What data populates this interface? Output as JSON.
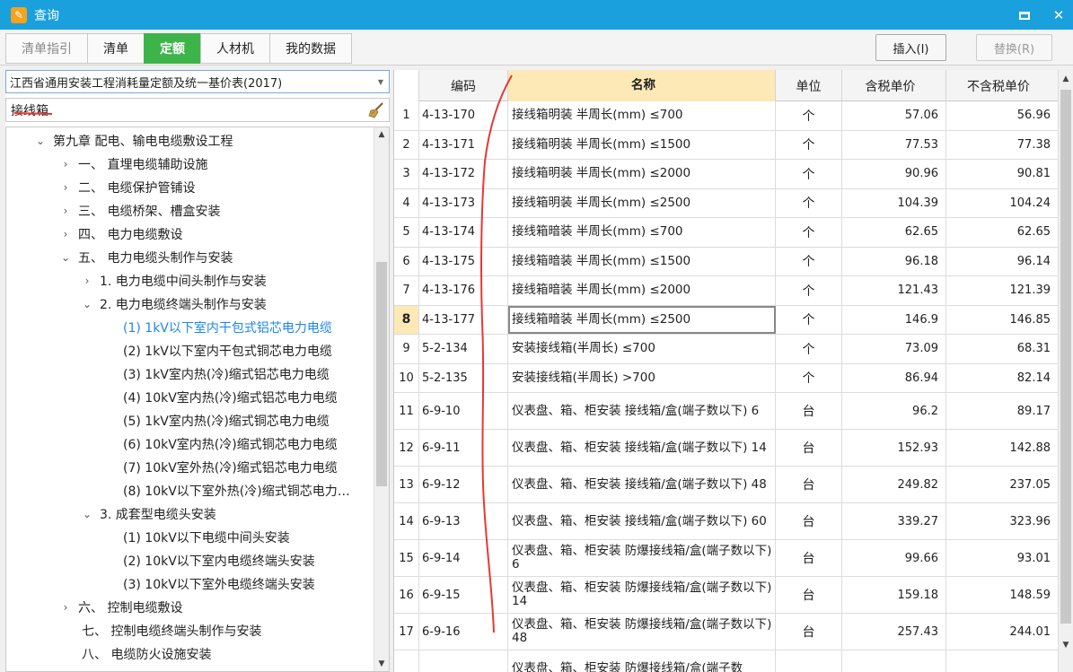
{
  "window": {
    "title": "查询",
    "app_icon": "app-logo-icon",
    "minimize_icon": "minimize-icon",
    "close_icon": "close-icon",
    "close_glyph": "✕"
  },
  "tabs": [
    {
      "label": "清单指引",
      "state": "disabled"
    },
    {
      "label": "清单",
      "state": "normal"
    },
    {
      "label": "定额",
      "state": "active"
    },
    {
      "label": "人材机",
      "state": "normal"
    },
    {
      "label": "我的数据",
      "state": "normal"
    }
  ],
  "toolbar": {
    "insert_label": "插入(I)",
    "replace_label": "替换(R)"
  },
  "library": {
    "selected": "江西省通用安装工程消耗量定额及统一基价表(2017)"
  },
  "search": {
    "value": "接线箱",
    "clear_icon": "broom-icon"
  },
  "tree": [
    {
      "label": "第九章 配电、输电电缆敷设工程",
      "arrow": "⌄"
    },
    {
      "label": "一、  直埋电缆辅助设施",
      "arrow": "›"
    },
    {
      "label": "二、  电缆保护管铺设",
      "arrow": "›"
    },
    {
      "label": "三、  电缆桥架、槽盒安装",
      "arrow": "›"
    },
    {
      "label": "四、  电力电缆敷设",
      "arrow": "›"
    },
    {
      "label": "五、  电力电缆头制作与安装",
      "arrow": "⌄"
    },
    {
      "label": "1. 电力电缆中间头制作与安装",
      "arrow": "›"
    },
    {
      "label": "2. 电力电缆终端头制作与安装",
      "arrow": "⌄"
    },
    {
      "label": "(1) 1kV以下室内干包式铝芯电力电缆",
      "arrow": ""
    },
    {
      "label": "(2) 1kV以下室内干包式铜芯电力电缆",
      "arrow": ""
    },
    {
      "label": "(3) 1kV室内热(冷)缩式铝芯电力电缆",
      "arrow": ""
    },
    {
      "label": "(4) 10kV室内热(冷)缩式铝芯电力电缆",
      "arrow": ""
    },
    {
      "label": "(5) 1kV室内热(冷)缩式铜芯电力电缆",
      "arrow": ""
    },
    {
      "label": "(6) 10kV室内热(冷)缩式铜芯电力电缆",
      "arrow": ""
    },
    {
      "label": "(7) 10kV室外热(冷)缩式铝芯电力电缆",
      "arrow": ""
    },
    {
      "label": "(8) 10kV以下室外热(冷)缩式铜芯电力…",
      "arrow": ""
    },
    {
      "label": "3. 成套型电缆头安装",
      "arrow": "⌄"
    },
    {
      "label": "(1) 10kV以下电缆中间头安装",
      "arrow": ""
    },
    {
      "label": "(2) 10kV以下室内电缆终端头安装",
      "arrow": ""
    },
    {
      "label": "(3) 10kV以下室外电缆终端头安装",
      "arrow": ""
    },
    {
      "label": "六、  控制电缆敷设",
      "arrow": "›"
    },
    {
      "label": "七、  控制电缆终端头制作与安装",
      "arrow": ""
    },
    {
      "label": "八、  电缆防火设施安装",
      "arrow": ""
    }
  ],
  "tree_selected_index": 8,
  "grid": {
    "headers": [
      "",
      "编码",
      "名称",
      "单位",
      "含税单价",
      "不含税单价"
    ],
    "rows": [
      {
        "idx": "1",
        "code": "4-13-170",
        "name": "接线箱明装 半周长(mm) ≤700",
        "unit": "个",
        "tax": "57.06",
        "notax": "56.96"
      },
      {
        "idx": "2",
        "code": "4-13-171",
        "name": "接线箱明装 半周长(mm) ≤1500",
        "unit": "个",
        "tax": "77.53",
        "notax": "77.38"
      },
      {
        "idx": "3",
        "code": "4-13-172",
        "name": "接线箱明装 半周长(mm) ≤2000",
        "unit": "个",
        "tax": "90.96",
        "notax": "90.81"
      },
      {
        "idx": "4",
        "code": "4-13-173",
        "name": "接线箱明装 半周长(mm) ≤2500",
        "unit": "个",
        "tax": "104.39",
        "notax": "104.24"
      },
      {
        "idx": "5",
        "code": "4-13-174",
        "name": "接线箱暗装 半周长(mm) ≤700",
        "unit": "个",
        "tax": "62.65",
        "notax": "62.65"
      },
      {
        "idx": "6",
        "code": "4-13-175",
        "name": "接线箱暗装 半周长(mm) ≤1500",
        "unit": "个",
        "tax": "96.18",
        "notax": "96.14"
      },
      {
        "idx": "7",
        "code": "4-13-176",
        "name": "接线箱暗装 半周长(mm) ≤2000",
        "unit": "个",
        "tax": "121.43",
        "notax": "121.39"
      },
      {
        "idx": "8",
        "code": "4-13-177",
        "name": "接线箱暗装 半周长(mm) ≤2500",
        "unit": "个",
        "tax": "146.9",
        "notax": "146.85"
      },
      {
        "idx": "9",
        "code": "5-2-134",
        "name": "安装接线箱(半周长) ≤700",
        "unit": "个",
        "tax": "73.09",
        "notax": "68.31"
      },
      {
        "idx": "10",
        "code": "5-2-135",
        "name": "安装接线箱(半周长) >700",
        "unit": "个",
        "tax": "86.94",
        "notax": "82.14"
      },
      {
        "idx": "11",
        "code": "6-9-10",
        "name": "仪表盘、箱、柜安装 接线箱/盒(端子数以下) 6",
        "unit": "台",
        "tax": "96.2",
        "notax": "89.17"
      },
      {
        "idx": "12",
        "code": "6-9-11",
        "name": "仪表盘、箱、柜安装 接线箱/盒(端子数以下) 14",
        "unit": "台",
        "tax": "152.93",
        "notax": "142.88"
      },
      {
        "idx": "13",
        "code": "6-9-12",
        "name": "仪表盘、箱、柜安装 接线箱/盒(端子数以下) 48",
        "unit": "台",
        "tax": "249.82",
        "notax": "237.05"
      },
      {
        "idx": "14",
        "code": "6-9-13",
        "name": "仪表盘、箱、柜安装 接线箱/盒(端子数以下) 60",
        "unit": "台",
        "tax": "339.27",
        "notax": "323.96"
      },
      {
        "idx": "15",
        "code": "6-9-14",
        "name": "仪表盘、箱、柜安装 防爆接线箱/盒(端子数以下) 6",
        "unit": "台",
        "tax": "99.66",
        "notax": "93.01"
      },
      {
        "idx": "16",
        "code": "6-9-15",
        "name": "仪表盘、箱、柜安装 防爆接线箱/盒(端子数以下) 14",
        "unit": "台",
        "tax": "159.18",
        "notax": "148.59"
      },
      {
        "idx": "17",
        "code": "6-9-16",
        "name": "仪表盘、箱、柜安装 防爆接线箱/盒(端子数以下) 48",
        "unit": "台",
        "tax": "257.43",
        "notax": "244.01"
      },
      {
        "idx": "",
        "code": "",
        "name": "仪表盘、箱、柜安装 防爆接线箱/盒(端子数",
        "unit": "",
        "tax": "",
        "notax": ""
      }
    ],
    "current_row_index": 7
  },
  "colors": {
    "titlebar": "#1aa0dc",
    "active_tab": "#3db44a",
    "header_highlight": "#fde9b5",
    "selected_tree": "#1e88e5",
    "annotation_ink": "#e53935"
  }
}
